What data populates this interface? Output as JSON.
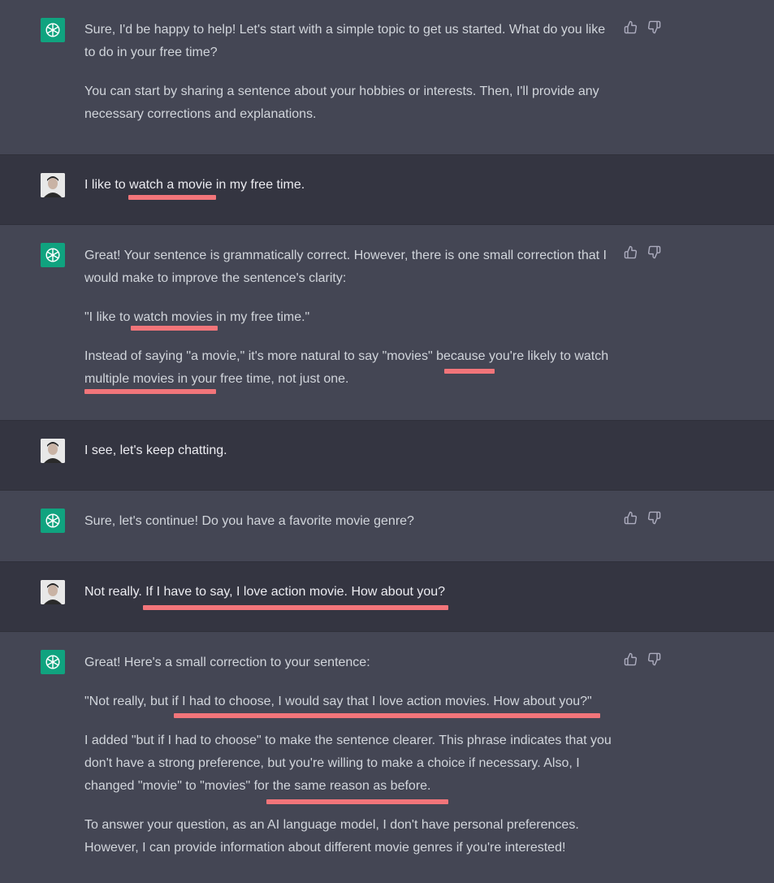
{
  "messages": [
    {
      "role": "assistant",
      "paragraphs": [
        "Sure, I'd be happy to help! Let's start with a simple topic to get us started. What do you like to do in your free time?",
        "You can start by sharing a sentence about your hobbies or interests. Then, I'll provide any necessary corrections and explanations."
      ]
    },
    {
      "role": "user",
      "paragraphs": [
        "I like to watch a movie in my free time."
      ]
    },
    {
      "role": "assistant",
      "paragraphs": [
        "Great! Your sentence is grammatically correct. However, there is one small correction that I would make to improve the sentence's clarity:",
        "\"I like to watch movies in my free time.\"",
        "Instead of saying \"a movie,\" it's more natural to say \"movies\" because you're likely to watch multiple movies in your free time, not just one."
      ]
    },
    {
      "role": "user",
      "paragraphs": [
        "I see, let's keep chatting."
      ]
    },
    {
      "role": "assistant",
      "paragraphs": [
        "Sure, let's continue! Do you have a favorite movie genre?"
      ]
    },
    {
      "role": "user",
      "paragraphs": [
        "Not really. If I have to say, I love action movie. How about you?"
      ]
    },
    {
      "role": "assistant",
      "paragraphs": [
        "Great! Here's a small correction to your sentence:",
        "\"Not really, but if I had to choose, I would say that I love action movies. How about you?\"",
        "I added \"but if I had to choose\" to make the sentence clearer. This phrase indicates that you don't have a strong preference, but you're willing to make a choice if necessary. Also, I changed \"movie\" to \"movies\" for the same reason as before.",
        "To answer your question, as an AI language model, I don't have personal preferences. However, I can provide information about different movie genres if you're interested!"
      ]
    }
  ],
  "icons": {
    "assistant_avatar": "openai-logo-icon",
    "user_avatar": "user-photo-avatar",
    "feedback": [
      "thumbs-up-icon",
      "thumbs-down-icon"
    ]
  },
  "colors": {
    "assistant_bg": "#444654",
    "user_bg": "#343541",
    "avatar_green": "#10a37f",
    "highlight": "#f2757a",
    "text": "#d1d5db"
  }
}
